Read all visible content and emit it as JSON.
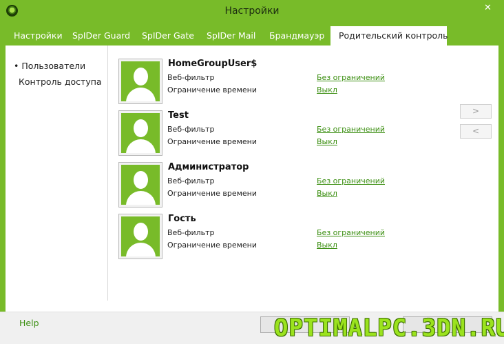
{
  "window": {
    "title": "Настройки",
    "close_glyph": "✕"
  },
  "tabs": [
    {
      "label": "Настройки"
    },
    {
      "label": "SpIDer Guard"
    },
    {
      "label": "SpIDer Gate"
    },
    {
      "label": "SpIDer Mail"
    },
    {
      "label": "Брандмауэр"
    },
    {
      "label": "Родительский контроль",
      "active": true
    }
  ],
  "sidebar": {
    "items": [
      {
        "label": "• Пользователи",
        "selected": true
      },
      {
        "label": "Контроль доступа"
      }
    ]
  },
  "users": [
    {
      "name": "HomeGroupUser$",
      "web_filter_label": "Веб-фильтр",
      "web_filter_value": "Без ограничений",
      "time_limit_label": "Ограничение времени",
      "time_limit_value": "Выкл"
    },
    {
      "name": "Test",
      "web_filter_label": "Веб-фильтр",
      "web_filter_value": "Без ограничений",
      "time_limit_label": "Ограничение времени",
      "time_limit_value": "Выкл"
    },
    {
      "name": "Администратор",
      "web_filter_label": "Веб-фильтр",
      "web_filter_value": "Без ограничений",
      "time_limit_label": "Ограничение времени",
      "time_limit_value": "Выкл"
    },
    {
      "name": "Гость",
      "web_filter_label": "Веб-фильтр",
      "web_filter_value": "Без ограничений",
      "time_limit_label": "Ограничение времени",
      "time_limit_value": "Выкл"
    }
  ],
  "nav": {
    "next_label": ">",
    "prev_label": "<"
  },
  "footer": {
    "help_label": "Help"
  },
  "watermark": {
    "text": "OPTIMALPC.3DN.RU"
  },
  "colors": {
    "accent": "#78bb29",
    "link": "#3c8f12",
    "watermark": "#9be31e"
  }
}
